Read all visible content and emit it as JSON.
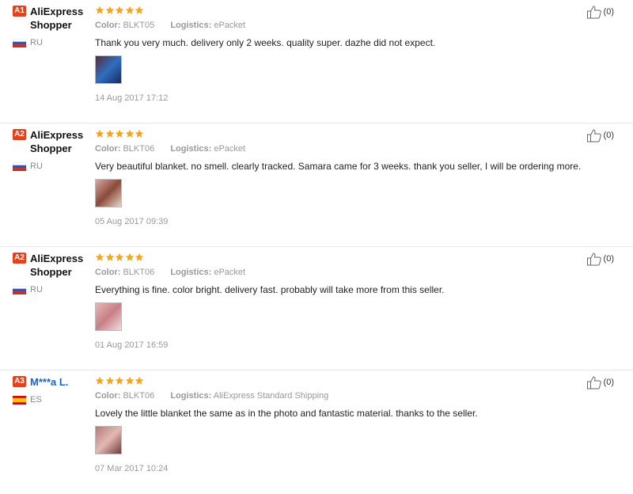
{
  "reviews": [
    {
      "badge": "A1",
      "user": "AliExpress Shopper",
      "user_is_link": false,
      "country": "RU",
      "flag": "ru-flag",
      "rating": 5,
      "color_label": "Color:",
      "color_value": "BLKT05",
      "logistics_label": "Logistics:",
      "logistics_value": "ePacket",
      "text": "Thank you very much. delivery only 2 weeks. quality super. dazhe did not expect.",
      "photo_colors": [
        "#5a2a3a",
        "#2f6fbf",
        "#1b2a60"
      ],
      "date": "14 Aug 2017 17:12",
      "helpful": "(0)"
    },
    {
      "badge": "A2",
      "user": "AliExpress Shopper",
      "user_is_link": false,
      "country": "RU",
      "flag": "ru-flag",
      "rating": 5,
      "color_label": "Color:",
      "color_value": "BLKT06",
      "logistics_label": "Logistics:",
      "logistics_value": "ePacket",
      "text": "Very beautiful blanket. no smell. clearly tracked. Samara came for 3 weeks. thank you seller, I will be ordering more.",
      "photo_colors": [
        "#d9a6a0",
        "#8a4a3c",
        "#e8d7c8"
      ],
      "date": "05 Aug 2017 09:39",
      "helpful": "(0)"
    },
    {
      "badge": "A2",
      "user": "AliExpress Shopper",
      "user_is_link": false,
      "country": "RU",
      "flag": "ru-flag",
      "rating": 5,
      "color_label": "Color:",
      "color_value": "BLKT06",
      "logistics_label": "Logistics:",
      "logistics_value": "ePacket",
      "text": "Everything is fine. color bright. delivery fast. probably will take more from this seller.",
      "photo_colors": [
        "#e6b8b8",
        "#c77f86",
        "#f2dcdc"
      ],
      "date": "01 Aug 2017 16:59",
      "helpful": "(0)"
    },
    {
      "badge": "A3",
      "user": "M***a L.",
      "user_is_link": true,
      "country": "ES",
      "flag": "es-flag",
      "rating": 5,
      "color_label": "Color:",
      "color_value": "BLKT06",
      "logistics_label": "Logistics:",
      "logistics_value": "AliExpress Standard Shipping",
      "text": "Lovely the little blanket the same as in the photo and fantastic material. thanks to the seller.",
      "photo_colors": [
        "#b57a7a",
        "#e4b9b3",
        "#6e3b3b"
      ],
      "date": "07 Mar 2017 10:24",
      "helpful": "(0)"
    }
  ],
  "colors": {
    "star": "#f7a41d",
    "badge": "#e0431e",
    "link": "#1a62c7"
  }
}
